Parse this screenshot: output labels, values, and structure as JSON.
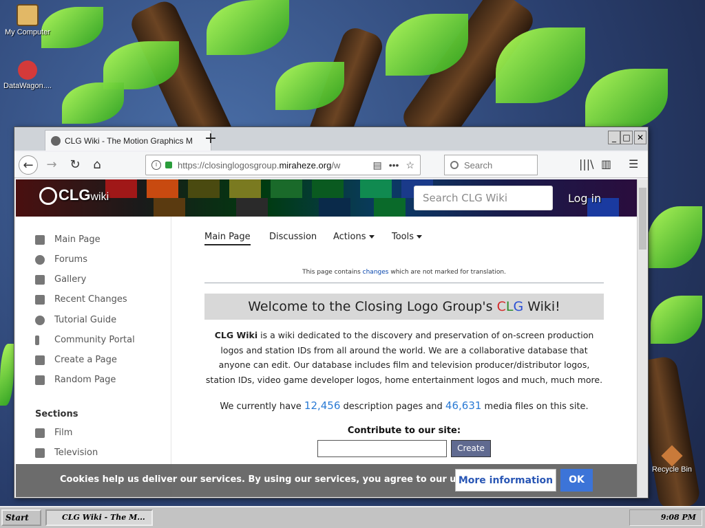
{
  "desktop": {
    "icons": [
      {
        "label": "My Computer"
      },
      {
        "label": "DataWagon...."
      },
      {
        "label": "Recycle Bin"
      }
    ]
  },
  "browser": {
    "tab_title": "CLG Wiki - The Motion Graphics M",
    "new_tab": "+",
    "url_prefix": "https://closinglogosgroup.",
    "url_domain": "miraheze.org",
    "url_suffix": "/w",
    "search_placeholder": "Search"
  },
  "site": {
    "logo": "CLG",
    "logo_suffix": "wiki",
    "search_placeholder": "Search CLG Wiki",
    "login": "Log in"
  },
  "sidebar": {
    "items": [
      {
        "label": "Main Page",
        "icon": "file-icon"
      },
      {
        "label": "Forums",
        "icon": "chat-icon"
      },
      {
        "label": "Gallery",
        "icon": "image-icon"
      },
      {
        "label": "Recent Changes",
        "icon": "chart-icon"
      },
      {
        "label": "Tutorial Guide",
        "icon": "question-icon"
      },
      {
        "label": "Community Portal",
        "icon": "person-icon"
      },
      {
        "label": "Create a Page",
        "icon": "plus-icon"
      },
      {
        "label": "Random Page",
        "icon": "dice-icon"
      }
    ],
    "sections_heading": "Sections",
    "sections": [
      {
        "label": "Film",
        "icon": "film-icon"
      },
      {
        "label": "Television",
        "icon": "monitor-icon"
      }
    ]
  },
  "page_tabs": {
    "main": "Main Page",
    "discussion": "Discussion",
    "actions": "Actions",
    "tools": "Tools"
  },
  "notice": {
    "before": "This page contains ",
    "link": "changes",
    "after": " which are not marked for translation."
  },
  "welcome": {
    "before": "Welcome to the Closing Logo Group's ",
    "c": "C",
    "l": "L",
    "g": "G",
    "after": " Wiki!"
  },
  "intro": {
    "bold": "CLG Wiki",
    "text": " is a wiki dedicated to the discovery and preservation of on-screen production logos and station IDs from all around the world. We are a collaborative database that anyone can edit. Our database includes film and television producer/distributor logos, station IDs, video game developer logos, home entertainment logos and much, much more."
  },
  "stats": {
    "before": "We currently have ",
    "pages": "12,456",
    "middle": " description pages and ",
    "media": "46,631",
    "after": " media files on this site."
  },
  "contribute": {
    "heading": "Contribute to our site:",
    "button": "Create"
  },
  "cookie": {
    "text": "Cookies help us deliver our services. By using our services, you agree to our use of cookies.",
    "more": "More information",
    "ok": "OK"
  },
  "taskbar": {
    "start": "Start",
    "task": "CLG Wiki - The M...",
    "clock": "9:08 PM"
  },
  "colors": {
    "link": "#0645ad",
    "accent_blue": "#2a7ad4",
    "cookie_ok": "#3c74d8"
  }
}
